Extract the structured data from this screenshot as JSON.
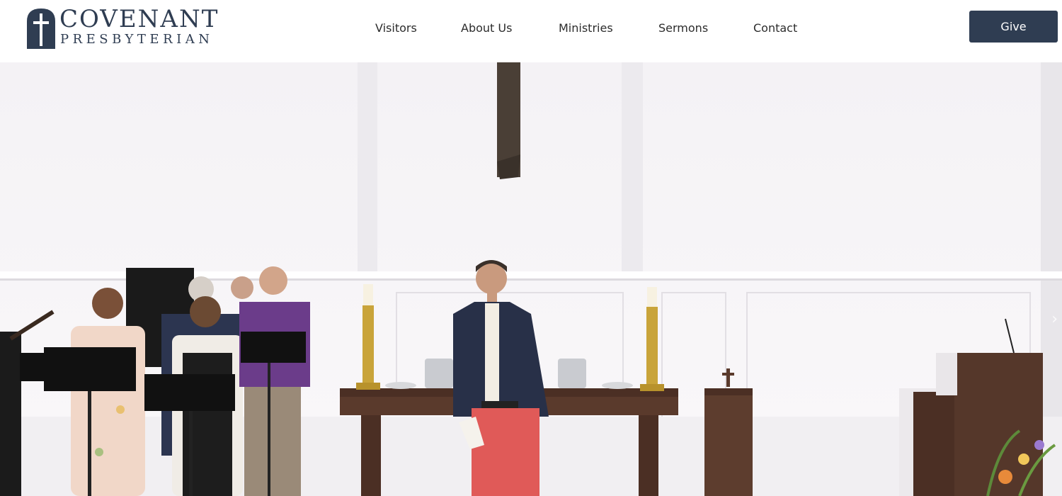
{
  "logo": {
    "line1": "COVENANT",
    "line2": "PRESBYTERIAN",
    "icon": "cross-window-icon",
    "color": "#2f3d52"
  },
  "nav": {
    "items": [
      "Visitors",
      "About Us",
      "Ministries",
      "Sermons",
      "Contact"
    ]
  },
  "give_label": "Give",
  "hero": {
    "next_icon": "chevron-right-icon"
  },
  "colors": {
    "brand": "#2f3d52",
    "nav_text": "#2c2c2c",
    "wall": "#f6f4f6"
  }
}
